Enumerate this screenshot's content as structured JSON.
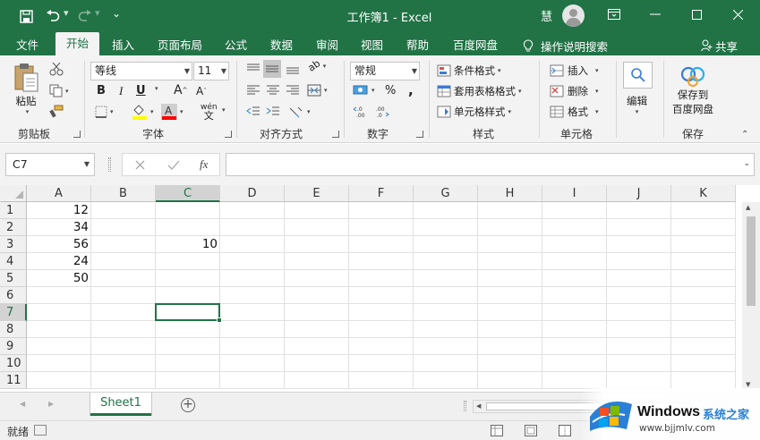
{
  "titlebar": {
    "title": "工作簿1  -  Excel",
    "user": "慧",
    "qat_more": "⌄"
  },
  "tabs": [
    {
      "label": "文件"
    },
    {
      "label": "开始"
    },
    {
      "label": "插入"
    },
    {
      "label": "页面布局"
    },
    {
      "label": "公式"
    },
    {
      "label": "数据"
    },
    {
      "label": "审阅"
    },
    {
      "label": "视图"
    },
    {
      "label": "帮助"
    },
    {
      "label": "百度网盘"
    },
    {
      "label": "操作说明搜索"
    }
  ],
  "share_label": "共享",
  "ribbon": {
    "clipboard": {
      "paste": "粘贴",
      "label": "剪贴板"
    },
    "font": {
      "name": "等线",
      "size": "11",
      "bold": "B",
      "italic": "I",
      "underline": "U",
      "grow": "A",
      "shrink": "A",
      "label": "字体",
      "wen": "wén",
      "wen_char": "文"
    },
    "alignment": {
      "label": "对齐方式",
      "orient": "ab"
    },
    "number": {
      "format": "常规",
      "percent": "%",
      "comma": ",",
      "label": "数字",
      "inc": "←.0\n.00",
      "dec": ".00\n→.0"
    },
    "styles": {
      "cond": "条件格式",
      "table": "套用表格格式",
      "cell": "单元格样式",
      "label": "样式"
    },
    "cells": {
      "insert": "插入",
      "delete": "删除",
      "format": "格式",
      "label": "单元格"
    },
    "editing": {
      "label": "编辑"
    },
    "save": {
      "line1": "保存到",
      "line2": "百度网盘",
      "label": "保存"
    }
  },
  "formula": {
    "namebox": "C7",
    "fx": "fx",
    "value": ""
  },
  "columns": [
    "A",
    "B",
    "C",
    "D",
    "E",
    "F",
    "G",
    "H",
    "I",
    "J",
    "K"
  ],
  "rows": [
    "1",
    "2",
    "3",
    "4",
    "5",
    "6",
    "7",
    "8",
    "9",
    "10",
    "11"
  ],
  "cells": {
    "A1": "12",
    "A2": "34",
    "A3": "56",
    "A4": "24",
    "A5": "50",
    "C3": "10"
  },
  "selected": {
    "col": "C",
    "row": "7"
  },
  "sheets": [
    {
      "name": "Sheet1"
    }
  ],
  "status": "就绪",
  "watermark": {
    "brand": "Windows",
    "cn": "系统之家",
    "url": "www.bjjmlv.com"
  },
  "colors": {
    "accent": "#217346",
    "ribbon_bg": "#f3f3f3"
  }
}
